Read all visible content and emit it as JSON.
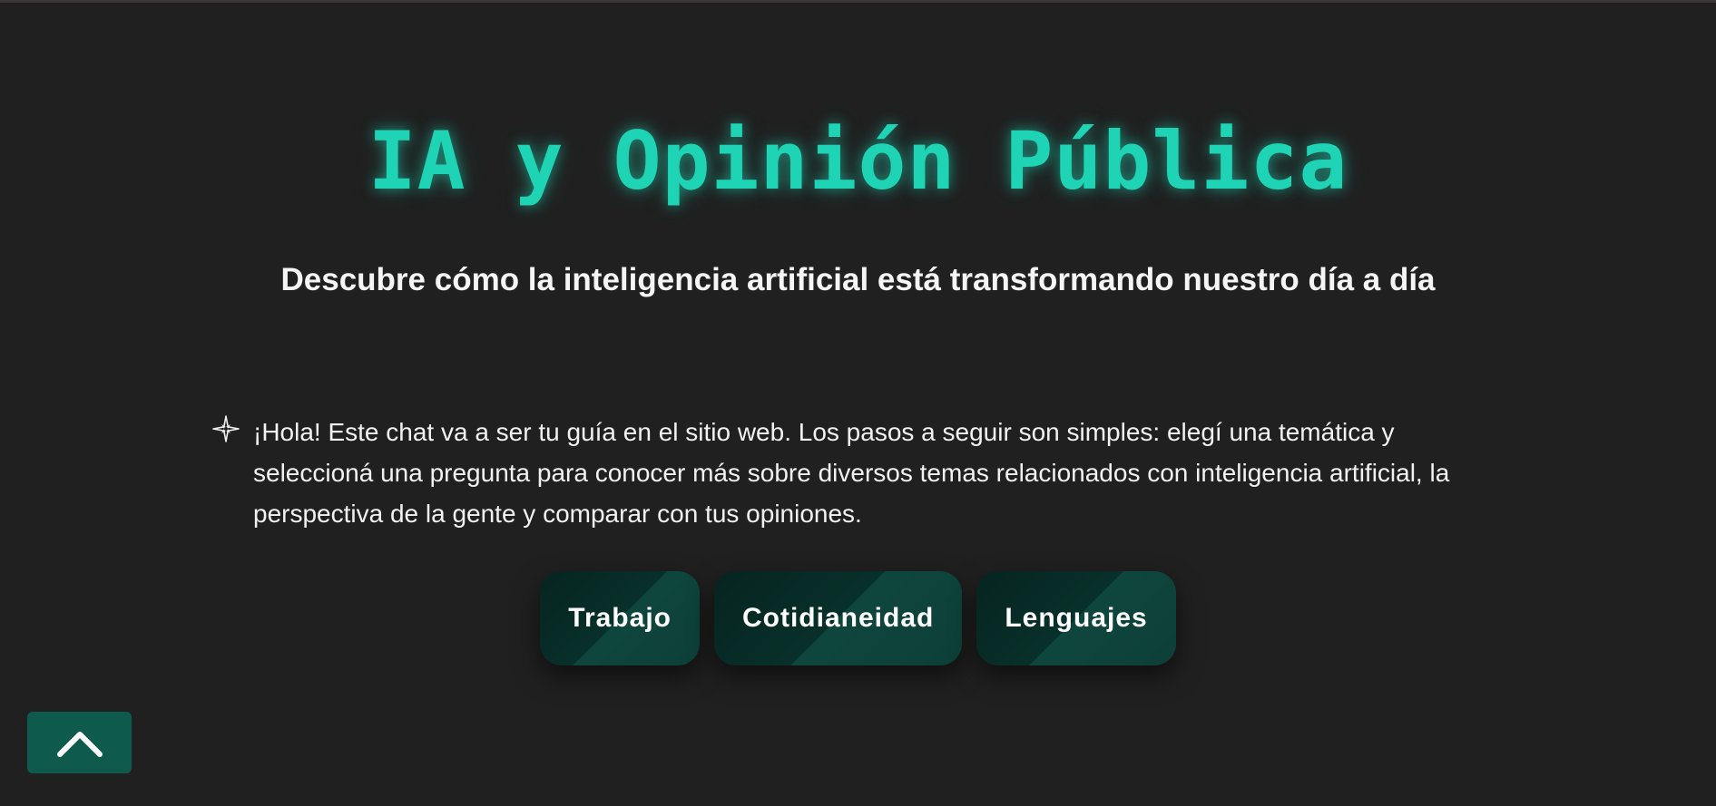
{
  "hero": {
    "title": "IA y Opinión Pública",
    "subtitle": "Descubre cómo la inteligencia artificial está transformando nuestro día a día"
  },
  "chat": {
    "icon": "compass-star-icon",
    "message": "¡Hola! Este chat va a ser tu guía en el sitio web. Los pasos a seguir son simples: elegí una temática y seleccioná una pregunta para conocer más sobre diversos temas relacionados con inteligencia artificial, la perspectiva de la gente y comparar con tus opiniones."
  },
  "topics": [
    {
      "label": "Trabajo"
    },
    {
      "label": "Cotidianeidad"
    },
    {
      "label": "Lenguajes"
    }
  ],
  "scroll_top": {
    "icon": "chevron-up-icon"
  },
  "colors": {
    "background": "#202020",
    "accent": "#1ed4b4",
    "button_dark": "#062420",
    "button_light": "#0e463e",
    "scroll_button": "#0e5a4d"
  }
}
